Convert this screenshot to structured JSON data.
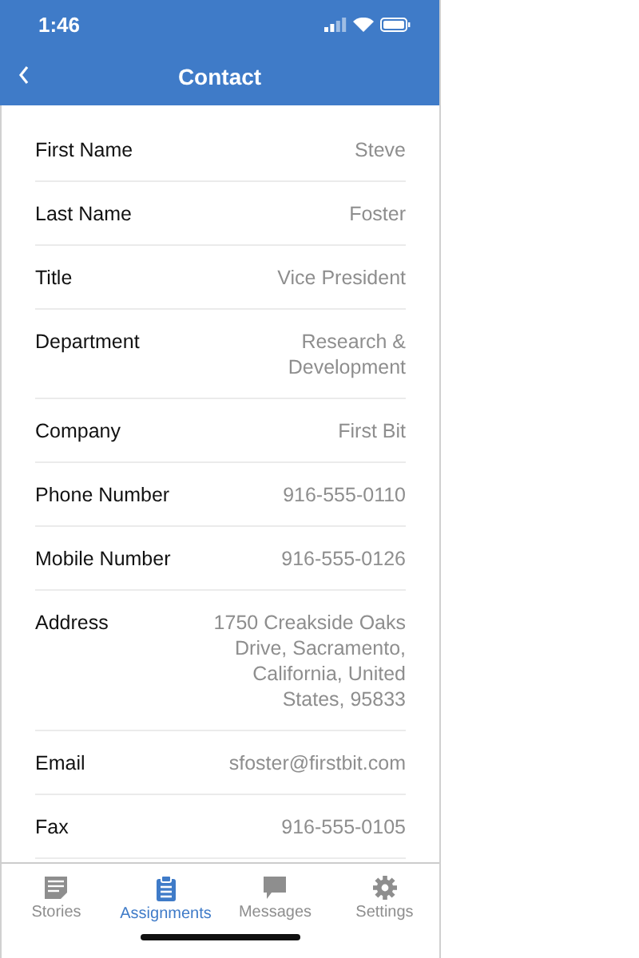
{
  "status_bar": {
    "time": "1:46"
  },
  "nav": {
    "title": "Contact"
  },
  "fields": [
    {
      "label": "First Name",
      "value": "Steve"
    },
    {
      "label": "Last Name",
      "value": "Foster"
    },
    {
      "label": "Title",
      "value": "Vice President"
    },
    {
      "label": "Department",
      "value": "Research & Development"
    },
    {
      "label": "Company",
      "value": "First Bit"
    },
    {
      "label": "Phone Number",
      "value": "916-555-0110"
    },
    {
      "label": "Mobile Number",
      "value": "916-555-0126"
    },
    {
      "label": "Address",
      "value": "1750 Creakside Oaks Drive, Sacramento, California, United States, 95833"
    },
    {
      "label": "Email",
      "value": "sfoster@firstbit.com"
    },
    {
      "label": "Fax",
      "value": "916-555-0105"
    }
  ],
  "tabs": [
    {
      "label": "Stories",
      "selected": false
    },
    {
      "label": "Assignments",
      "selected": true
    },
    {
      "label": "Messages",
      "selected": false
    },
    {
      "label": "Settings",
      "selected": false
    }
  ]
}
